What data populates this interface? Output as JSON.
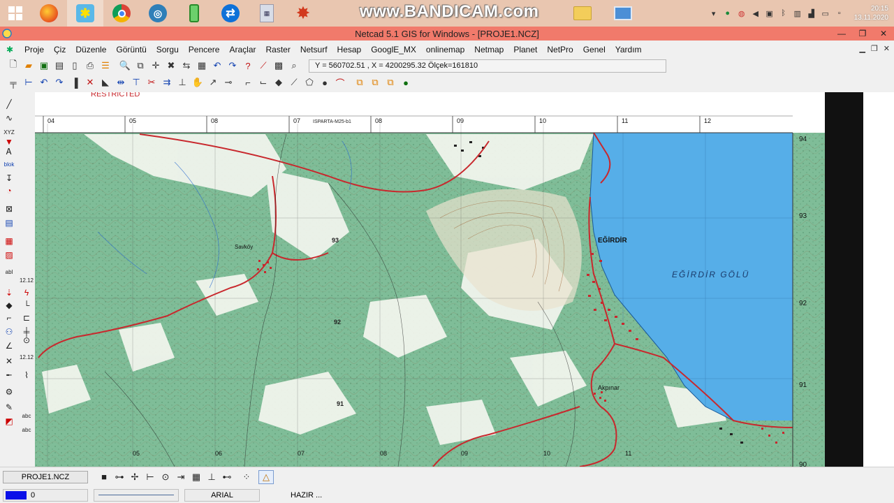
{
  "taskbar": {
    "watermark": "www.BANDICAM.com",
    "clock_time": "20:15",
    "clock_date": "13.11.2020",
    "apps": [
      "windows-start",
      "firefox",
      "netcad",
      "chrome",
      "magnifier",
      "battery-app",
      "teamviewer",
      "calculator",
      "app-red",
      "bandicam",
      "folder",
      "monitor"
    ]
  },
  "window": {
    "title": "Netcad 5.1 GIS for Windows - [PROJE1.NCZ]"
  },
  "menu": {
    "items": [
      "Proje",
      "Çiz",
      "Düzenle",
      "Görüntü",
      "Sorgu",
      "Pencere",
      "Araçlar",
      "Raster",
      "Netsurf",
      "Hesap",
      "GooglE_MX",
      "onlinemap",
      "Netmap",
      "Planet",
      "NetPro",
      "Genel",
      "Yardım"
    ]
  },
  "toolbar": {
    "coordinates": "Y = 560702.51 , X = 4200295.32  Ölçek=161810"
  },
  "map": {
    "top_ticks": [
      "04",
      "05",
      "08",
      "07",
      "08",
      "09",
      "10",
      "11",
      "12"
    ],
    "bottom_ticks": [
      "05",
      "06",
      "07",
      "08",
      "09",
      "10",
      "11"
    ],
    "right_ticks": [
      "94",
      "93",
      "92",
      "91",
      "90"
    ],
    "restricted": "RESTRICTED",
    "sheet_label": "ISPARTA-M25-b1",
    "lake_name": "EĞİRDİR GÖLÜ",
    "town_main": "EĞİRDİR",
    "town_1": "Savköy",
    "town_2": "Akpınar",
    "grid_labels": [
      "93",
      "92",
      "91"
    ]
  },
  "status": {
    "project": "PROJE1.NCZ",
    "layer_value": "0",
    "font": "ARIAL",
    "state": "HAZIR ..."
  },
  "colors": {
    "taskbar": "#e9c6b0",
    "titlebar": "#f17a6b",
    "lake": "#56aee8",
    "forest": "#7fbd98",
    "road": "#c8282d"
  }
}
